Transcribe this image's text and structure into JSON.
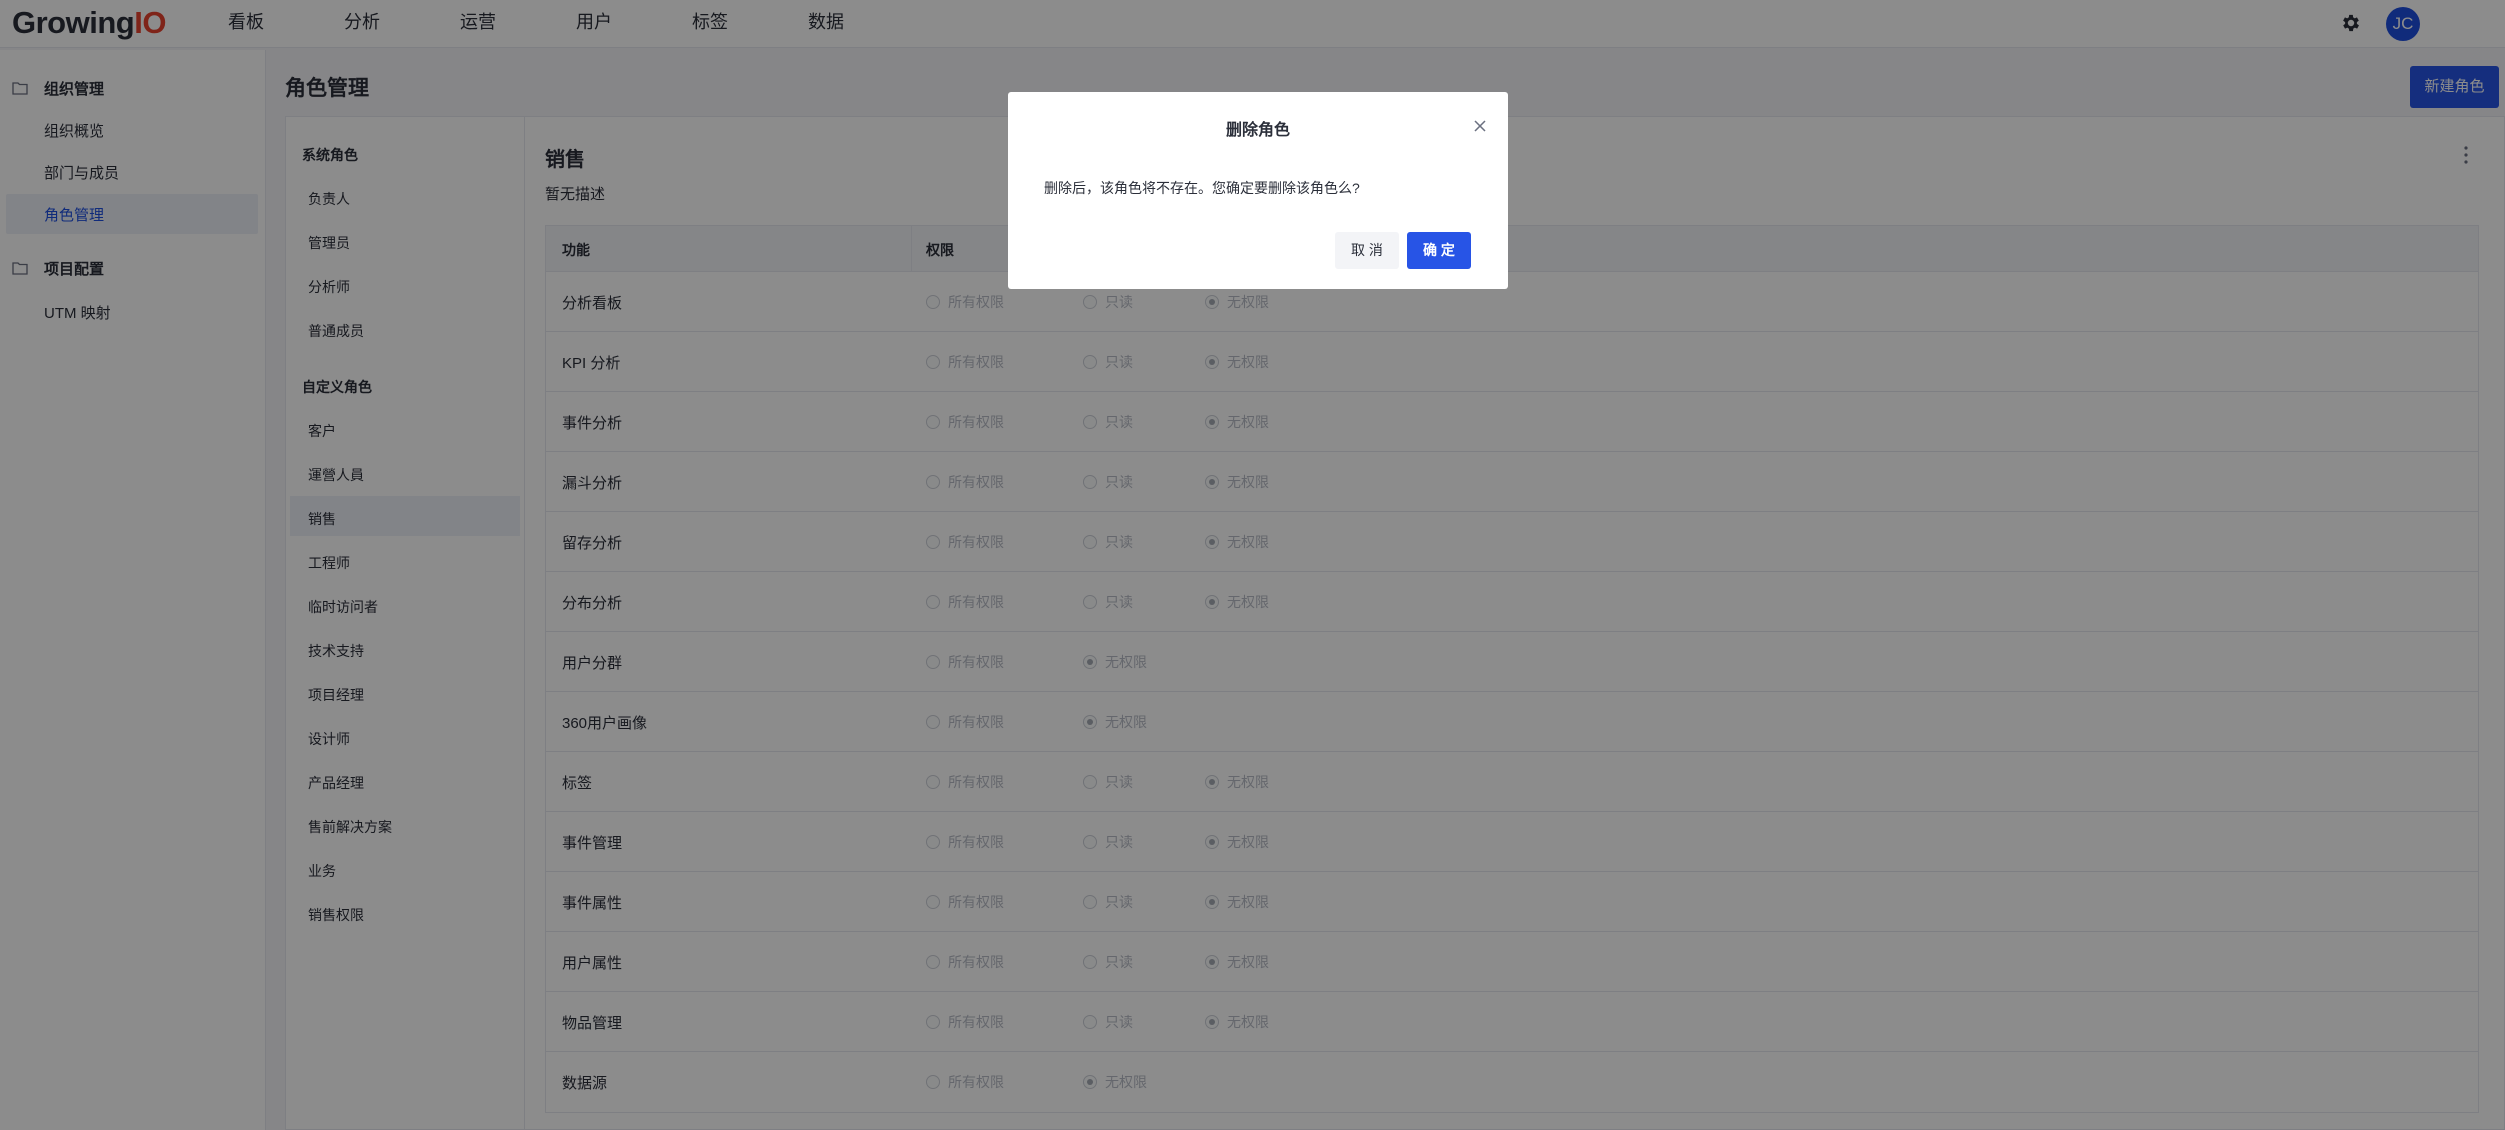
{
  "brand": {
    "logo_main": "Growing",
    "logo_io": "IO"
  },
  "nav": [
    "看板",
    "分析",
    "运营",
    "用户",
    "标签",
    "数据"
  ],
  "user": {
    "initials": "JC"
  },
  "sidebar": {
    "groups": [
      {
        "label": "组织管理",
        "items": [
          "组织概览",
          "部门与成员",
          "角色管理"
        ]
      },
      {
        "label": "项目配置",
        "items": [
          "UTM 映射"
        ]
      }
    ],
    "active_item": "角色管理"
  },
  "page": {
    "title": "角色管理",
    "new_role_label": "新建角色"
  },
  "roles": {
    "system_heading": "系统角色",
    "system": [
      "负责人",
      "管理员",
      "分析师",
      "普通成员"
    ],
    "custom_heading": "自定义角色",
    "custom": [
      "客户",
      "運營人員",
      "销售",
      "工程师",
      "临时访问者",
      "技术支持",
      "项目经理",
      "设计师",
      "产品经理",
      "售前解决方案",
      "业务",
      "销售权限"
    ],
    "selected": "销售"
  },
  "detail": {
    "title": "销售",
    "description": "暂无描述",
    "table": {
      "headers": [
        "功能",
        "权限"
      ],
      "rows": [
        {
          "func": "分析看板",
          "options": [
            "所有权限",
            "只读",
            "无权限"
          ],
          "selected": 2
        },
        {
          "func": "KPI 分析",
          "options": [
            "所有权限",
            "只读",
            "无权限"
          ],
          "selected": 2
        },
        {
          "func": "事件分析",
          "options": [
            "所有权限",
            "只读",
            "无权限"
          ],
          "selected": 2
        },
        {
          "func": "漏斗分析",
          "options": [
            "所有权限",
            "只读",
            "无权限"
          ],
          "selected": 2
        },
        {
          "func": "留存分析",
          "options": [
            "所有权限",
            "只读",
            "无权限"
          ],
          "selected": 2
        },
        {
          "func": "分布分析",
          "options": [
            "所有权限",
            "只读",
            "无权限"
          ],
          "selected": 2
        },
        {
          "func": "用户分群",
          "options": [
            "所有权限",
            "无权限"
          ],
          "selected": 1
        },
        {
          "func": "360用户画像",
          "options": [
            "所有权限",
            "无权限"
          ],
          "selected": 1
        },
        {
          "func": "标签",
          "options": [
            "所有权限",
            "只读",
            "无权限"
          ],
          "selected": 2
        },
        {
          "func": "事件管理",
          "options": [
            "所有权限",
            "只读",
            "无权限"
          ],
          "selected": 2
        },
        {
          "func": "事件属性",
          "options": [
            "所有权限",
            "只读",
            "无权限"
          ],
          "selected": 2
        },
        {
          "func": "用户属性",
          "options": [
            "所有权限",
            "只读",
            "无权限"
          ],
          "selected": 2
        },
        {
          "func": "物品管理",
          "options": [
            "所有权限",
            "只读",
            "无权限"
          ],
          "selected": 2
        },
        {
          "func": "数据源",
          "options": [
            "所有权限",
            "无权限"
          ],
          "selected": 1
        }
      ]
    }
  },
  "modal": {
    "title": "删除角色",
    "body": "删除后，该角色将不存在。您确定要删除该角色么?",
    "cancel_label": "取 消",
    "ok_label": "确 定"
  },
  "colors": {
    "primary": "#2754e6",
    "logo_accent": "#e8432f",
    "mask": "rgba(0,0,0,0.45)"
  }
}
